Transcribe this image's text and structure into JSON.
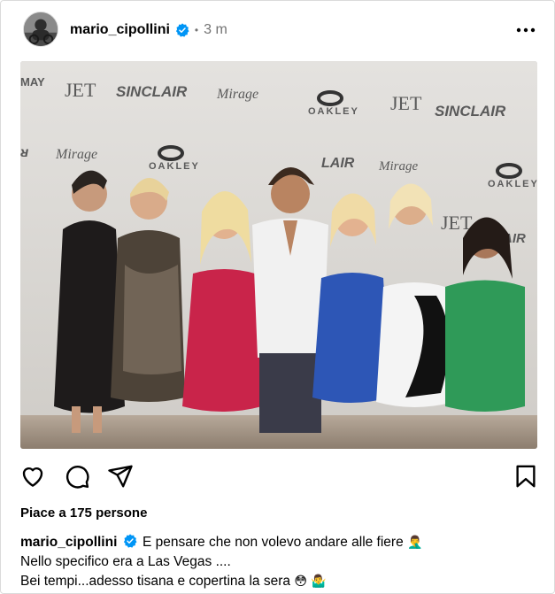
{
  "post": {
    "username": "mario_cipollini",
    "separator": "•",
    "time_ago": "3 m",
    "likes_text": "Piace a 175 persone",
    "caption": {
      "username": "mario_cipollini",
      "line1": "E pensare che non volevo andare alle fiere",
      "line1_emoji": "🤦‍♂️",
      "line2": "Nello specifico era a Las Vegas ....",
      "line3": "Bei tempi...adesso tisana e copertina la sera",
      "line3_emojis": "😳 🤷‍♂️"
    },
    "photo": {
      "backdrop_logos": [
        "JET",
        "SINCLAIR",
        "Mirage",
        "OAKLEY"
      ]
    }
  },
  "icons": {
    "verified": "verified-badge-icon",
    "more": "more-options-icon",
    "like": "heart-icon",
    "comment": "comment-icon",
    "share": "send-icon",
    "save": "bookmark-icon"
  },
  "colors": {
    "verified_blue": "#0095f6",
    "meta_gray": "#737373",
    "border": "#dbdbdb"
  }
}
